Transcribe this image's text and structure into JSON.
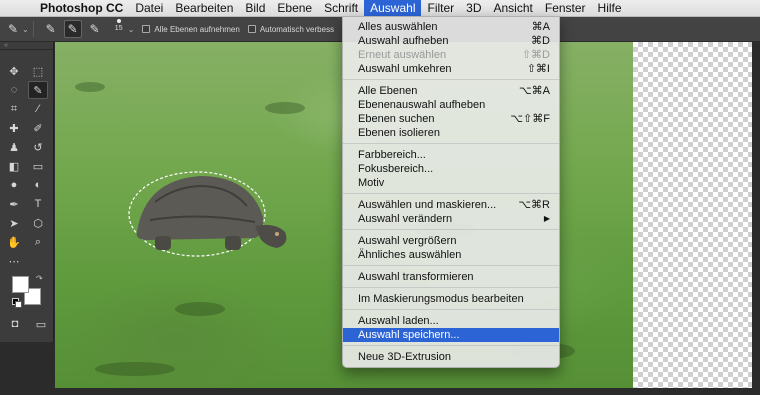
{
  "menubar": {
    "apple": "",
    "app_name": "Photoshop CC",
    "items": [
      "Datei",
      "Bearbeiten",
      "Bild",
      "Ebene",
      "Schrift",
      "Auswahl",
      "Filter",
      "3D",
      "Ansicht",
      "Fenster",
      "Hilfe"
    ],
    "active_item": "Auswahl"
  },
  "options_bar": {
    "brush_size": "15",
    "sample_all_layers_label": "Alle Ebenen aufnehmen",
    "auto_enhance_label": "Automatisch verbess"
  },
  "auswahl_menu": {
    "groups": [
      [
        {
          "label": "Alles auswählen",
          "shortcut": "⌘A",
          "enabled": true
        },
        {
          "label": "Auswahl aufheben",
          "shortcut": "⌘D",
          "enabled": true
        },
        {
          "label": "Erneut auswählen",
          "shortcut": "⇧⌘D",
          "enabled": false
        },
        {
          "label": "Auswahl umkehren",
          "shortcut": "⇧⌘I",
          "enabled": true
        }
      ],
      [
        {
          "label": "Alle Ebenen",
          "shortcut": "⌥⌘A",
          "enabled": true
        },
        {
          "label": "Ebenenauswahl aufheben",
          "shortcut": "",
          "enabled": true
        },
        {
          "label": "Ebenen suchen",
          "shortcut": "⌥⇧⌘F",
          "enabled": true
        },
        {
          "label": "Ebenen isolieren",
          "shortcut": "",
          "enabled": true
        }
      ],
      [
        {
          "label": "Farbbereich...",
          "shortcut": "",
          "enabled": true
        },
        {
          "label": "Fokusbereich...",
          "shortcut": "",
          "enabled": true
        },
        {
          "label": "Motiv",
          "shortcut": "",
          "enabled": true
        }
      ],
      [
        {
          "label": "Auswählen und maskieren...",
          "shortcut": "⌥⌘R",
          "enabled": true
        },
        {
          "label": "Auswahl verändern",
          "shortcut": "",
          "submenu": true,
          "enabled": true
        }
      ],
      [
        {
          "label": "Auswahl vergrößern",
          "shortcut": "",
          "enabled": true
        },
        {
          "label": "Ähnliches auswählen",
          "shortcut": "",
          "enabled": true
        }
      ],
      [
        {
          "label": "Auswahl transformieren",
          "shortcut": "",
          "enabled": true
        }
      ],
      [
        {
          "label": "Im Maskierungsmodus bearbeiten",
          "shortcut": "",
          "enabled": true
        }
      ],
      [
        {
          "label": "Auswahl laden...",
          "shortcut": "",
          "enabled": true
        },
        {
          "label": "Auswahl speichern...",
          "shortcut": "",
          "enabled": true,
          "highlighted": true
        }
      ],
      [
        {
          "label": "Neue 3D-Extrusion",
          "shortcut": "",
          "enabled": true
        }
      ]
    ]
  },
  "toolbar": {
    "tools": [
      "move-tool",
      "marquee-tool",
      "lasso-tool",
      "quick-selection-tool",
      "crop-tool",
      "eyedropper-tool",
      "healing-brush-tool",
      "brush-tool",
      "clone-stamp-tool",
      "history-brush-tool",
      "eraser-tool",
      "gradient-tool",
      "blur-tool",
      "dodge-tool",
      "pen-tool",
      "type-tool",
      "path-selection-tool",
      "shape-tool",
      "hand-tool",
      "zoom-tool"
    ],
    "selected_tool": "quick-selection-tool",
    "foreground_color": "#ffffff",
    "background_color": "#ffffff"
  },
  "colors": {
    "menu_highlight": "#2c64d6",
    "panel_dark": "#3c3c3c"
  }
}
